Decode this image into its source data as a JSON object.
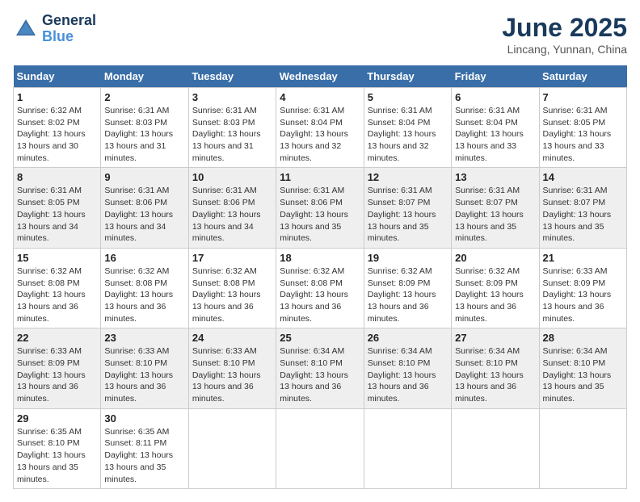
{
  "header": {
    "logo_line1": "General",
    "logo_line2": "Blue",
    "month_title": "June 2025",
    "location": "Lincang, Yunnan, China"
  },
  "weekdays": [
    "Sunday",
    "Monday",
    "Tuesday",
    "Wednesday",
    "Thursday",
    "Friday",
    "Saturday"
  ],
  "weeks": [
    [
      {
        "day": "1",
        "sunrise": "6:32 AM",
        "sunset": "8:02 PM",
        "daylight": "13 hours and 30 minutes."
      },
      {
        "day": "2",
        "sunrise": "6:31 AM",
        "sunset": "8:03 PM",
        "daylight": "13 hours and 31 minutes."
      },
      {
        "day": "3",
        "sunrise": "6:31 AM",
        "sunset": "8:03 PM",
        "daylight": "13 hours and 31 minutes."
      },
      {
        "day": "4",
        "sunrise": "6:31 AM",
        "sunset": "8:04 PM",
        "daylight": "13 hours and 32 minutes."
      },
      {
        "day": "5",
        "sunrise": "6:31 AM",
        "sunset": "8:04 PM",
        "daylight": "13 hours and 32 minutes."
      },
      {
        "day": "6",
        "sunrise": "6:31 AM",
        "sunset": "8:04 PM",
        "daylight": "13 hours and 33 minutes."
      },
      {
        "day": "7",
        "sunrise": "6:31 AM",
        "sunset": "8:05 PM",
        "daylight": "13 hours and 33 minutes."
      }
    ],
    [
      {
        "day": "8",
        "sunrise": "6:31 AM",
        "sunset": "8:05 PM",
        "daylight": "13 hours and 34 minutes."
      },
      {
        "day": "9",
        "sunrise": "6:31 AM",
        "sunset": "8:06 PM",
        "daylight": "13 hours and 34 minutes."
      },
      {
        "day": "10",
        "sunrise": "6:31 AM",
        "sunset": "8:06 PM",
        "daylight": "13 hours and 34 minutes."
      },
      {
        "day": "11",
        "sunrise": "6:31 AM",
        "sunset": "8:06 PM",
        "daylight": "13 hours and 35 minutes."
      },
      {
        "day": "12",
        "sunrise": "6:31 AM",
        "sunset": "8:07 PM",
        "daylight": "13 hours and 35 minutes."
      },
      {
        "day": "13",
        "sunrise": "6:31 AM",
        "sunset": "8:07 PM",
        "daylight": "13 hours and 35 minutes."
      },
      {
        "day": "14",
        "sunrise": "6:31 AM",
        "sunset": "8:07 PM",
        "daylight": "13 hours and 35 minutes."
      }
    ],
    [
      {
        "day": "15",
        "sunrise": "6:32 AM",
        "sunset": "8:08 PM",
        "daylight": "13 hours and 36 minutes."
      },
      {
        "day": "16",
        "sunrise": "6:32 AM",
        "sunset": "8:08 PM",
        "daylight": "13 hours and 36 minutes."
      },
      {
        "day": "17",
        "sunrise": "6:32 AM",
        "sunset": "8:08 PM",
        "daylight": "13 hours and 36 minutes."
      },
      {
        "day": "18",
        "sunrise": "6:32 AM",
        "sunset": "8:08 PM",
        "daylight": "13 hours and 36 minutes."
      },
      {
        "day": "19",
        "sunrise": "6:32 AM",
        "sunset": "8:09 PM",
        "daylight": "13 hours and 36 minutes."
      },
      {
        "day": "20",
        "sunrise": "6:32 AM",
        "sunset": "8:09 PM",
        "daylight": "13 hours and 36 minutes."
      },
      {
        "day": "21",
        "sunrise": "6:33 AM",
        "sunset": "8:09 PM",
        "daylight": "13 hours and 36 minutes."
      }
    ],
    [
      {
        "day": "22",
        "sunrise": "6:33 AM",
        "sunset": "8:09 PM",
        "daylight": "13 hours and 36 minutes."
      },
      {
        "day": "23",
        "sunrise": "6:33 AM",
        "sunset": "8:10 PM",
        "daylight": "13 hours and 36 minutes."
      },
      {
        "day": "24",
        "sunrise": "6:33 AM",
        "sunset": "8:10 PM",
        "daylight": "13 hours and 36 minutes."
      },
      {
        "day": "25",
        "sunrise": "6:34 AM",
        "sunset": "8:10 PM",
        "daylight": "13 hours and 36 minutes."
      },
      {
        "day": "26",
        "sunrise": "6:34 AM",
        "sunset": "8:10 PM",
        "daylight": "13 hours and 36 minutes."
      },
      {
        "day": "27",
        "sunrise": "6:34 AM",
        "sunset": "8:10 PM",
        "daylight": "13 hours and 36 minutes."
      },
      {
        "day": "28",
        "sunrise": "6:34 AM",
        "sunset": "8:10 PM",
        "daylight": "13 hours and 35 minutes."
      }
    ],
    [
      {
        "day": "29",
        "sunrise": "6:35 AM",
        "sunset": "8:10 PM",
        "daylight": "13 hours and 35 minutes."
      },
      {
        "day": "30",
        "sunrise": "6:35 AM",
        "sunset": "8:11 PM",
        "daylight": "13 hours and 35 minutes."
      },
      null,
      null,
      null,
      null,
      null
    ]
  ],
  "labels": {
    "sunrise": "Sunrise:",
    "sunset": "Sunset:",
    "daylight": "Daylight: 13 hours"
  }
}
